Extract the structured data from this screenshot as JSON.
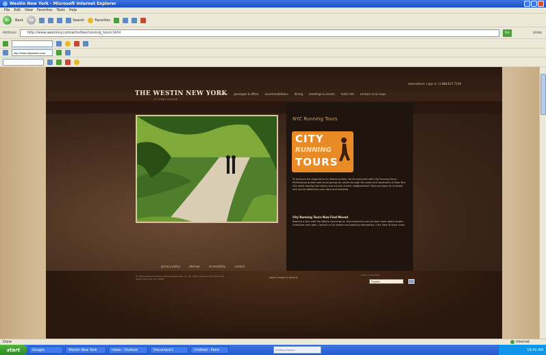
{
  "window": {
    "title": "Westin New York - Microsoft Internet Explorer"
  },
  "menu": [
    "File",
    "Edit",
    "View",
    "Favorites",
    "Tools",
    "Help"
  ],
  "toolbar": {
    "back_label": "Back",
    "search_label": "Search",
    "favorites_label": "Favorites"
  },
  "address": {
    "label": "Address",
    "url": "http://www.westinny.com/activities/running_tours.html",
    "go_label": "Go",
    "links_label": "Links"
  },
  "google_bar": {
    "search_value": "http://www.citysearch.com"
  },
  "site": {
    "logo": "THE WESTIN NEW YORK",
    "logo_sub": "AT TIMES SQUARE",
    "top_links": "reservations | sign in | 1.888.627.7149",
    "nav": [
      "home",
      "packages & offers",
      "accommodations",
      "dining",
      "meetings & events",
      "hotel info",
      "contact us & maps"
    ],
    "panel_title": "NYC Running Tours",
    "running_logo": {
      "city": "CITY",
      "running": "RUNNING",
      "tours": "TOURS"
    },
    "para1": "To enhance the experience for Westin guests, we've partnered with City Running Tours. Professional guides lead small groups on routes through the parks and landmarks of New York City while sharing the history and culture of each neighborhood. Tours are open to all levels and can be tailored to your pace and interests.",
    "para2_heading": "City Running Tours Now Find Moved",
    "para2": "Reserve a tour with the Westin concierge or visit citysearch.com to learn more about routes, schedules and rates. Contact us for details and booking information. Click here to learn more.",
    "footer_links": [
      "privacy policy",
      "sitemap",
      "accessibility",
      "contact"
    ],
    "footer_text": "© 2008 Starwood Hotels & Resorts Worldwide, Inc. All rights reserved. 270 West 43rd Street, New York, NY 10036.",
    "footer_mid": "Westin Hotels & Resorts",
    "footer_right": "Select a language",
    "lang_select": "English"
  },
  "status": {
    "left": "Done",
    "zone": "Internet"
  },
  "taskbar": {
    "start": "start",
    "tasks": [
      "Google",
      "Westin New York",
      "Inbox - Outlook",
      "Document1",
      "Untitled - Paint"
    ],
    "search_placeholder": "Desktop Search",
    "clock": "10:42 AM"
  }
}
